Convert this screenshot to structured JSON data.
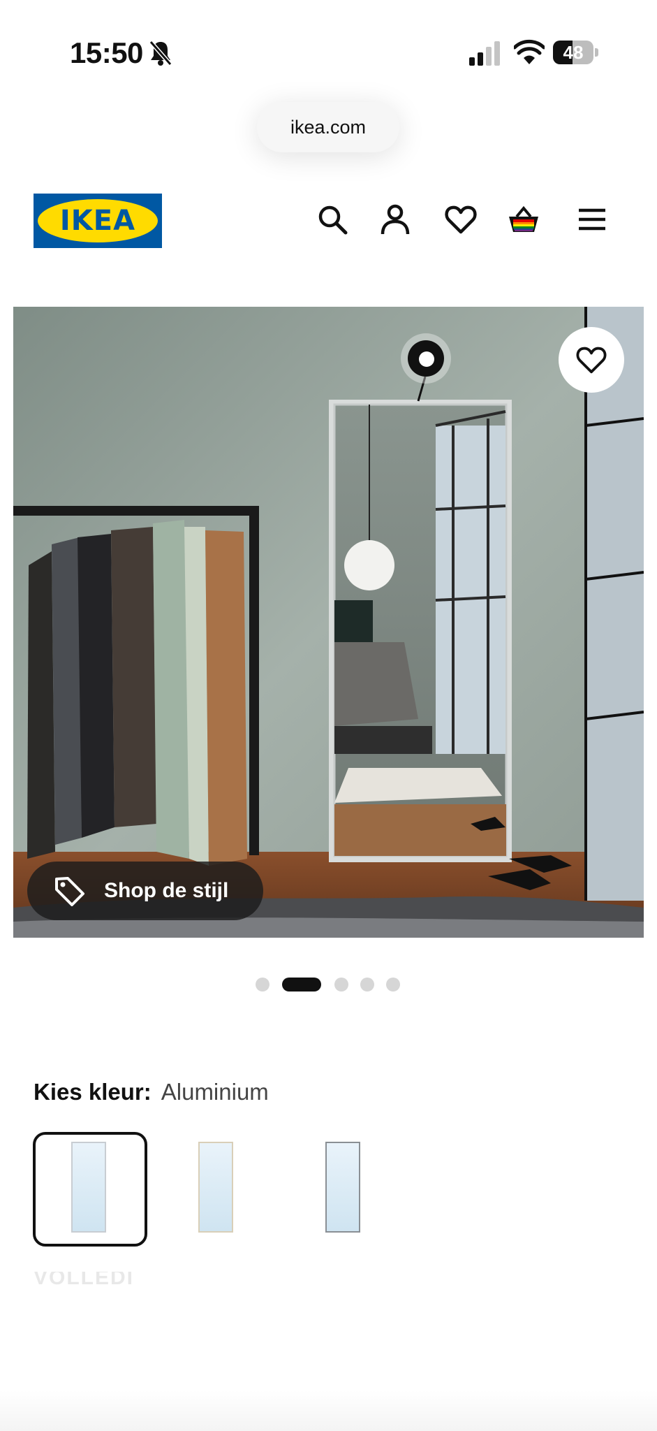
{
  "status_bar": {
    "time": "15:50",
    "battery": "48",
    "battery_percent": 48,
    "icons": [
      "bell-muted-icon",
      "cellular-signal-icon",
      "wifi-icon",
      "battery-icon"
    ]
  },
  "browser": {
    "url": "ikea.com"
  },
  "header": {
    "logo_text": "IKEA",
    "icons": [
      "search-icon",
      "account-icon",
      "favorites-icon",
      "shopping-bag-icon",
      "menu-icon"
    ]
  },
  "hero": {
    "shop_label": "Shop de stijl",
    "icons": [
      "heart-icon",
      "tag-icon",
      "hotspot-icon"
    ]
  },
  "carousel": {
    "count": 5,
    "active_index": 1
  },
  "color_picker": {
    "label": "Kies kleur:",
    "selected": "Aluminium",
    "options": [
      {
        "frame_color": "#c8cdd2"
      },
      {
        "frame_color": "#d9cfb8"
      },
      {
        "frame_color": "#8a8f94"
      }
    ]
  },
  "colors": {
    "ikea_blue": "#0058a3",
    "ikea_yellow": "#ffdb00",
    "text": "#111111"
  },
  "faded_heading": "VOLLEDIG"
}
